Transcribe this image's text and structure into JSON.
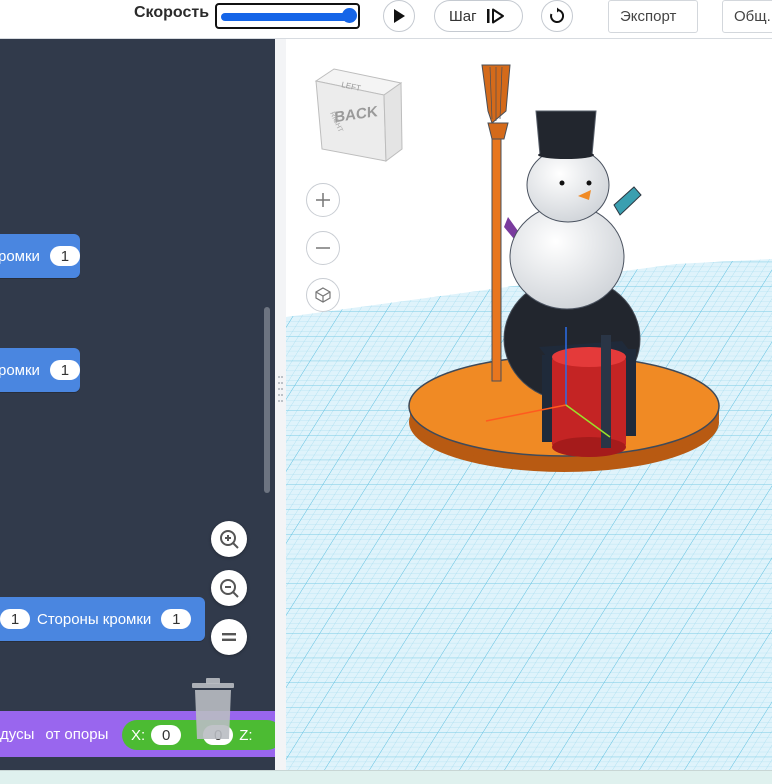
{
  "toolbar": {
    "speed_label": "Скорость",
    "speed_value": 1.0,
    "play_icon": "play-icon",
    "step_label": "Шаг",
    "step_icon": "step-forward-icon",
    "reset_icon": "reset-icon",
    "export_label": "Экспорт",
    "share_label": "Общ. д"
  },
  "code_panel": {
    "blocks": [
      {
        "text": "ромки",
        "value": "1"
      },
      {
        "text": "ромки",
        "value": "1"
      },
      {
        "value_a": "1",
        "text": "Стороны кромки",
        "value_b": "1"
      }
    ],
    "bottom_block": {
      "text_a": "дусы",
      "text_b": "от опоры",
      "x_label": "X:",
      "x_value": "0",
      "y_value": "0",
      "z_label": "Z:"
    },
    "zoom_icons": [
      "zoom-in-icon",
      "zoom-out-icon",
      "zoom-reset-icon"
    ],
    "trash_icon": "trash-icon"
  },
  "viewport": {
    "view_cube_label": "BACK",
    "view_cube_top": "LEFT",
    "view_cube_side": "RIGHT",
    "nav_icons": [
      "zoom-in-icon",
      "zoom-out-icon",
      "home-view-icon"
    ],
    "colors": {
      "grid": "#8fd3ea",
      "base": "#f08a24",
      "gift_box": "#d42a2a",
      "snow": "#f2f2f2",
      "dark": "#22262e",
      "broom": "#e8761e"
    }
  }
}
